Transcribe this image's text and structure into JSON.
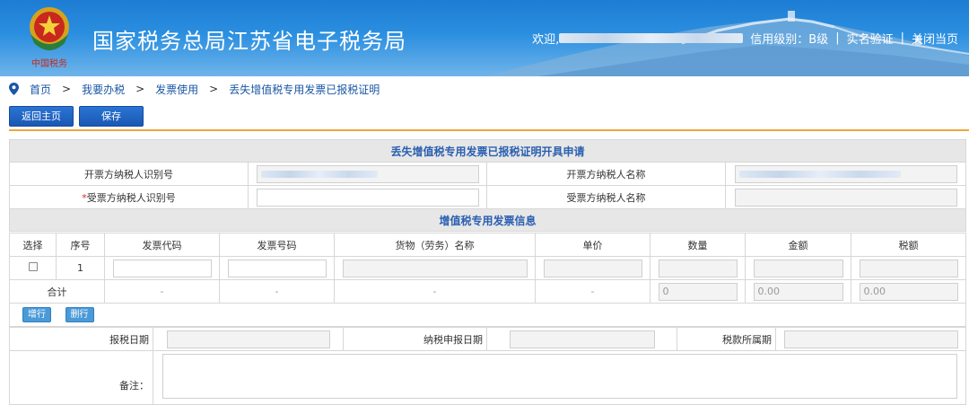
{
  "header": {
    "title": "国家税务总局江苏省电子税务局",
    "welcome": "欢迎,",
    "credit_level": "信用级别：B级",
    "verify": "实名验证",
    "close": "关闭当页",
    "sep": "|"
  },
  "breadcrumb": {
    "items": [
      "首页",
      "我要办税",
      "发票使用",
      "丢失增值税专用发票已报税证明"
    ],
    "arrow": ">"
  },
  "toolbar": {
    "back_label": "返回主页",
    "save_label": "保存"
  },
  "form": {
    "section1_title": "丢失增值税专用发票已报税证明开具申请",
    "issuer_id_label": "开票方纳税人识别号",
    "issuer_name_label": "开票方纳税人名称",
    "required_mark": "*",
    "receiver_id_label": "受票方纳税人识别号",
    "receiver_name_label": "受票方纳税人名称",
    "section2_title": "增值税专用发票信息"
  },
  "invoice_table": {
    "headers": [
      "选择",
      "序号",
      "发票代码",
      "发票号码",
      "货物（劳务）名称",
      "单价",
      "数量",
      "金额",
      "税额"
    ],
    "row_index": "1",
    "total_label": "合计",
    "dash": "-",
    "total_quantity": "0",
    "total_amount": "0.00",
    "total_tax": "0.00",
    "add_row": "增行",
    "delete_row": "删行"
  },
  "footer_fields": {
    "report_date_label": "报税日期",
    "declare_date_label": "纳税申报日期",
    "tax_period_label": "税款所属期",
    "remark_label": "备注："
  },
  "colors": {
    "header_blue": "#1d7cd3",
    "link_blue": "#1a57a4",
    "button_blue": "#1a58b3",
    "accent_orange": "#f0a63a",
    "section_title": "#2a5fb0"
  }
}
